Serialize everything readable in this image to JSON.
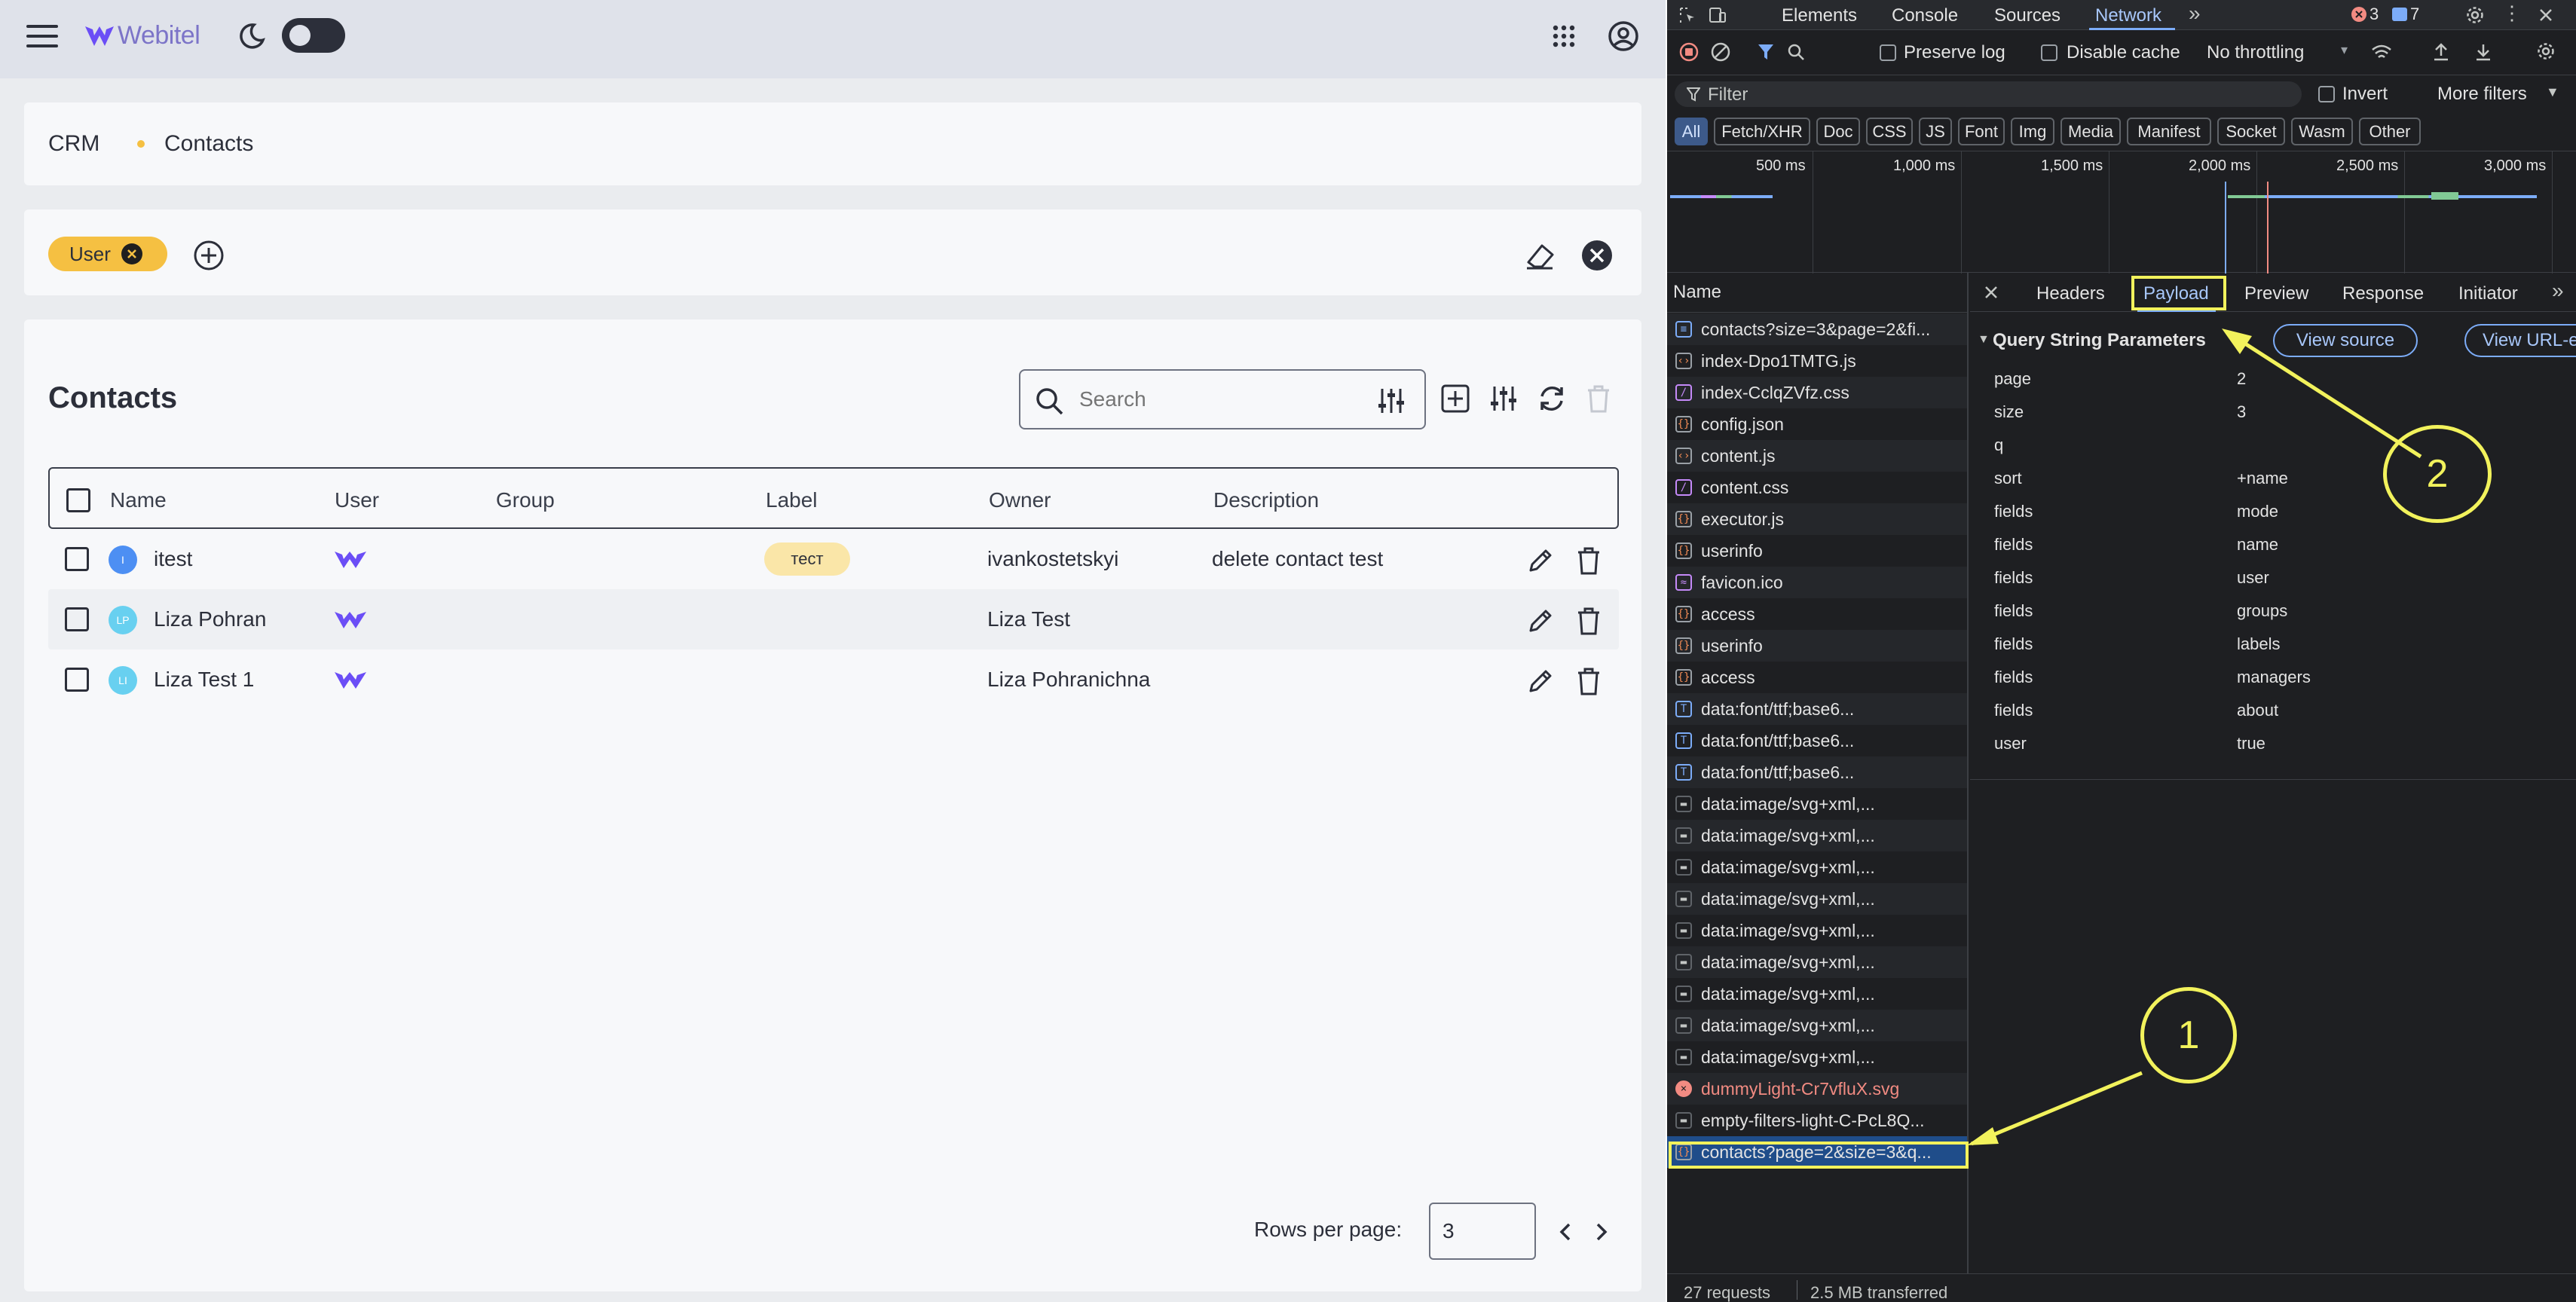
{
  "app": {
    "logo_text": "Webitel",
    "breadcrumb": {
      "root": "CRM",
      "current": "Contacts"
    },
    "filter_chip": "User",
    "title": "Contacts",
    "search_placeholder": "Search",
    "columns": [
      "Name",
      "User",
      "Group",
      "Label",
      "Owner",
      "Description"
    ],
    "rows": [
      {
        "initials": "I",
        "name": "itest",
        "avatar_color": "#4d8ff3",
        "label": "тест",
        "owner": "ivankostetskyi",
        "description": "delete contact test"
      },
      {
        "initials": "LP",
        "name": "Liza Pohran",
        "avatar_color": "#68d0f0",
        "label": "",
        "owner": "Liza Test",
        "description": ""
      },
      {
        "initials": "LI",
        "name": "Liza Test 1",
        "avatar_color": "#68d0f0",
        "label": "",
        "owner": "Liza Pohranichna",
        "description": ""
      }
    ],
    "rows_per_page_label": "Rows per page:",
    "rows_per_page_value": "3",
    "colors": {
      "accent": "#f5c042",
      "brand": "#6b4ef6",
      "topbar": "#dfe2ea"
    }
  },
  "devtools": {
    "tabs": [
      "Elements",
      "Console",
      "Sources",
      "Network"
    ],
    "active_tab": "Network",
    "error_count": "3",
    "message_count": "7",
    "toolbar": {
      "preserve_log": "Preserve log",
      "disable_cache": "Disable cache",
      "throttling": "No throttling"
    },
    "filter_placeholder": "Filter",
    "invert": "Invert",
    "more_filters": "More filters",
    "type_filters": [
      "All",
      "Fetch/XHR",
      "Doc",
      "CSS",
      "JS",
      "Font",
      "Img",
      "Media",
      "Manifest",
      "Socket",
      "Wasm",
      "Other"
    ],
    "timeline_ticks": [
      "500 ms",
      "1,000 ms",
      "1,500 ms",
      "2,000 ms",
      "2,500 ms",
      "3,000 ms"
    ],
    "name_header": "Name",
    "requests": [
      {
        "name": "contacts?size=3&page=2&fi...",
        "icon": "doc-icon",
        "error": false
      },
      {
        "name": "index-Dpo1TMTG.js",
        "icon": "js-icon",
        "error": false
      },
      {
        "name": "index-CclqZVfz.css",
        "icon": "css-icon",
        "error": false
      },
      {
        "name": "config.json",
        "icon": "fetch-icon",
        "error": false
      },
      {
        "name": "content.js",
        "icon": "js-icon",
        "error": false
      },
      {
        "name": "content.css",
        "icon": "css-icon",
        "error": false
      },
      {
        "name": "executor.js",
        "icon": "fetch-icon",
        "error": false
      },
      {
        "name": "userinfo",
        "icon": "fetch-icon",
        "error": false
      },
      {
        "name": "favicon.ico",
        "icon": "favicon-icon",
        "error": false
      },
      {
        "name": "access",
        "icon": "fetch-icon",
        "error": false
      },
      {
        "name": "userinfo",
        "icon": "fetch-icon",
        "error": false
      },
      {
        "name": "access",
        "icon": "fetch-icon",
        "error": false
      },
      {
        "name": "data:font/ttf;base6...",
        "icon": "font-icon",
        "error": false
      },
      {
        "name": "data:font/ttf;base6...",
        "icon": "font-icon",
        "error": false
      },
      {
        "name": "data:font/ttf;base6...",
        "icon": "font-icon",
        "error": false
      },
      {
        "name": "data:image/svg+xml,...",
        "icon": "image-icon",
        "error": false
      },
      {
        "name": "data:image/svg+xml,...",
        "icon": "image-icon",
        "error": false
      },
      {
        "name": "data:image/svg+xml,...",
        "icon": "image-icon",
        "error": false
      },
      {
        "name": "data:image/svg+xml,...",
        "icon": "image-icon",
        "error": false
      },
      {
        "name": "data:image/svg+xml,...",
        "icon": "image-icon",
        "error": false
      },
      {
        "name": "data:image/svg+xml,...",
        "icon": "image-icon",
        "error": false
      },
      {
        "name": "data:image/svg+xml,...",
        "icon": "image-icon",
        "error": false
      },
      {
        "name": "data:image/svg+xml,...",
        "icon": "image-icon",
        "error": false
      },
      {
        "name": "data:image/svg+xml,...",
        "icon": "image-icon",
        "error": false
      },
      {
        "name": "dummyLight-Cr7vfluX.svg",
        "icon": "error-icon",
        "error": true
      },
      {
        "name": "empty-filters-light-C-PcL8Q...",
        "icon": "image-icon",
        "error": false
      },
      {
        "name": "contacts?page=2&size=3&q...",
        "icon": "fetch-icon",
        "error": false,
        "selected": true
      }
    ],
    "detail_tabs": [
      "Headers",
      "Payload",
      "Preview",
      "Response",
      "Initiator"
    ],
    "active_detail_tab": "Payload",
    "section_title": "Query String Parameters",
    "view_source": "View source",
    "view_url": "View URL-e",
    "params": [
      {
        "key": "page",
        "value": "2"
      },
      {
        "key": "size",
        "value": "3"
      },
      {
        "key": "q",
        "value": ""
      },
      {
        "key": "sort",
        "value": "+name"
      },
      {
        "key": "fields",
        "value": "mode"
      },
      {
        "key": "fields",
        "value": "name"
      },
      {
        "key": "fields",
        "value": "user"
      },
      {
        "key": "fields",
        "value": "groups"
      },
      {
        "key": "fields",
        "value": "labels"
      },
      {
        "key": "fields",
        "value": "managers"
      },
      {
        "key": "fields",
        "value": "about"
      },
      {
        "key": "user",
        "value": "true"
      }
    ],
    "status_requests": "27 requests",
    "status_transferred": "2.5 MB transferred",
    "annotations": [
      "1",
      "2"
    ],
    "colors": {
      "bg": "#1e1f22",
      "accent": "#7cacf8",
      "annotation": "#f2f25c",
      "error": "#f28b82"
    }
  }
}
